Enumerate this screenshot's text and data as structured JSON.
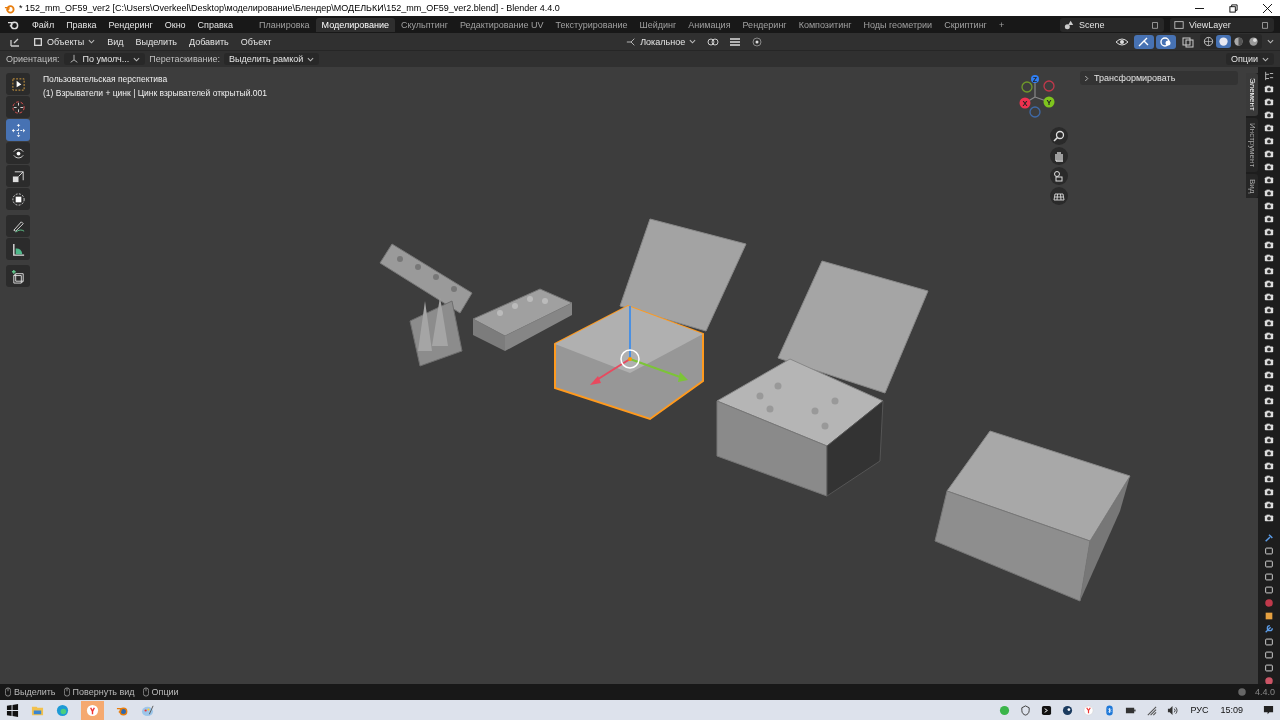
{
  "window": {
    "title": "* 152_mm_OF59_ver2 [C:\\Users\\Overkeel\\Desktop\\моделирование\\Блендер\\МОДЕЛЬКИ\\152_mm_OF59_ver2.blend] - Blender 4.4.0"
  },
  "menu": [
    "Файл",
    "Правка",
    "Рендеринг",
    "Окно",
    "Справка"
  ],
  "workspaces": [
    {
      "label": "Планировка",
      "selected": false
    },
    {
      "label": "Моделирование",
      "selected": true
    },
    {
      "label": "Скульптинг",
      "selected": false
    },
    {
      "label": "Редактирование UV",
      "selected": false
    },
    {
      "label": "Текстурирование",
      "selected": false
    },
    {
      "label": "Шейдинг",
      "selected": false
    },
    {
      "label": "Анимация",
      "selected": false
    },
    {
      "label": "Рендеринг",
      "selected": false
    },
    {
      "label": "Композитинг",
      "selected": false
    },
    {
      "label": "Ноды геометрии",
      "selected": false
    },
    {
      "label": "Скриптинг",
      "selected": false
    }
  ],
  "add_workspace": "+",
  "scene": "Scene",
  "view_layer": "ViewLayer",
  "header": {
    "mode": "Объекты",
    "menus": [
      "Вид",
      "Выделить",
      "Добавить",
      "Объект"
    ],
    "orientation": "Локальное",
    "gizmos": {
      "on": true
    },
    "overlays": {
      "on": true
    },
    "shading": [
      {
        "kind": "wireframe",
        "selected": false
      },
      {
        "kind": "solid",
        "selected": true
      },
      {
        "kind": "material",
        "selected": false
      },
      {
        "kind": "rendered",
        "selected": false
      }
    ]
  },
  "tool_settings": {
    "orientation_label": "Ориентация:",
    "orientation_value": "По умолч...",
    "drag_label": "Перетаскивание:",
    "drag_value": "Выделить рамкой",
    "options": "Опции"
  },
  "viewport": {
    "info": [
      "Пользовательская перспектива",
      "(1) Взрыватели + цинк | Цинк взрывателей открытый.001"
    ],
    "tools": [
      {
        "kind": "select",
        "selected": false
      },
      {
        "kind": "cursor",
        "selected": false
      },
      {
        "kind": "move",
        "selected": true
      },
      {
        "kind": "rotate",
        "selected": false
      },
      {
        "kind": "scale",
        "selected": false
      },
      {
        "kind": "transform",
        "selected": false
      },
      {
        "kind": "annotate",
        "selected": false
      },
      {
        "kind": "measure",
        "selected": false
      },
      {
        "kind": "add-cube",
        "selected": false
      }
    ],
    "axes": [
      "X",
      "Y",
      "Z"
    ]
  },
  "sidebar": {
    "panel": "Трансформировать",
    "expanded": false,
    "tabs": [
      {
        "label": "Элемент",
        "selected": true
      },
      {
        "label": "Инструмент",
        "selected": false
      },
      {
        "label": "Вид",
        "selected": false
      }
    ]
  },
  "status_bar": {
    "hints": [
      "Выделить",
      "Повернуть вид",
      "Опции"
    ],
    "version": "4.4.0"
  },
  "taskbar": {
    "language": "РУС",
    "time": "15:09"
  }
}
